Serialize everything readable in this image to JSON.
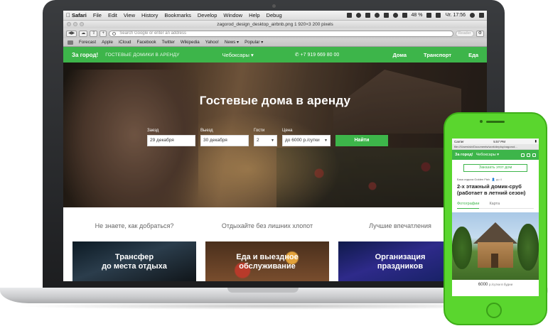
{
  "macos": {
    "menus": [
      "Safari",
      "File",
      "Edit",
      "View",
      "History",
      "Bookmarks",
      "Develop",
      "Window",
      "Help",
      "Debug"
    ],
    "battery": "48 %",
    "clock": "Чт. 17:56"
  },
  "browser": {
    "window_title": "zagorod_design_desktop_airbnb.png 1 920×3 200 pixels",
    "address_placeholder": "Search Google or enter an address",
    "reader_label": "Reader",
    "bookmarks": [
      "Forecast",
      "Apple",
      "iCloud",
      "Facebook",
      "Twitter",
      "Wikipedia",
      "Yahoo!",
      "News ▾",
      "Popular ▾"
    ]
  },
  "site": {
    "logo": "За город!",
    "tagline": "ГОСТЕВЫЕ ДОМИКИ В АРЕНДУ",
    "city": "Чебоксары",
    "phone": "+7 919 669 80 00",
    "nav": [
      "Дома",
      "Транспорт",
      "Еда"
    ],
    "hero_title": "Гостевые дома в аренду",
    "search": {
      "checkin_label": "Заезд",
      "checkin_value": "29 декабря",
      "checkout_label": "Выезд",
      "checkout_value": "30 декабря",
      "guests_label": "Гости",
      "guests_value": "2",
      "price_label": "Цена",
      "price_value": "до 6000 р./сутки",
      "submit": "Найти"
    },
    "features": [
      {
        "heading": "Не знаете, как добраться?",
        "card_line1": "Трансфер",
        "card_line2": "до места отдыха"
      },
      {
        "heading": "Отдыхайте без лишних хлопот",
        "card_line1": "Еда и выездное",
        "card_line2": "обслуживание"
      },
      {
        "heading": "Лучшие впечатления",
        "card_line1": "Организация",
        "card_line2": "праздников"
      }
    ]
  },
  "mobile": {
    "status_left": "Carrier",
    "status_time": "5:57 PM",
    "url": "file:///Users/slx/Documents/work/deploy/zagorod...",
    "logo": "За город!",
    "city": "Чебоксары",
    "order_button": "Заказать этот дом",
    "base_name": "База отдыха Golden Fish",
    "guests": "до 4",
    "title": "2-х этажный домик-сруб (работает в летний сезон)",
    "tab_photos": "Фотографии",
    "tab_map": "Карта",
    "price": "6000",
    "price_unit": "р./сутки в будни"
  },
  "colors": {
    "brand_green": "#3db54a",
    "phone_green": "#5ad62e"
  }
}
